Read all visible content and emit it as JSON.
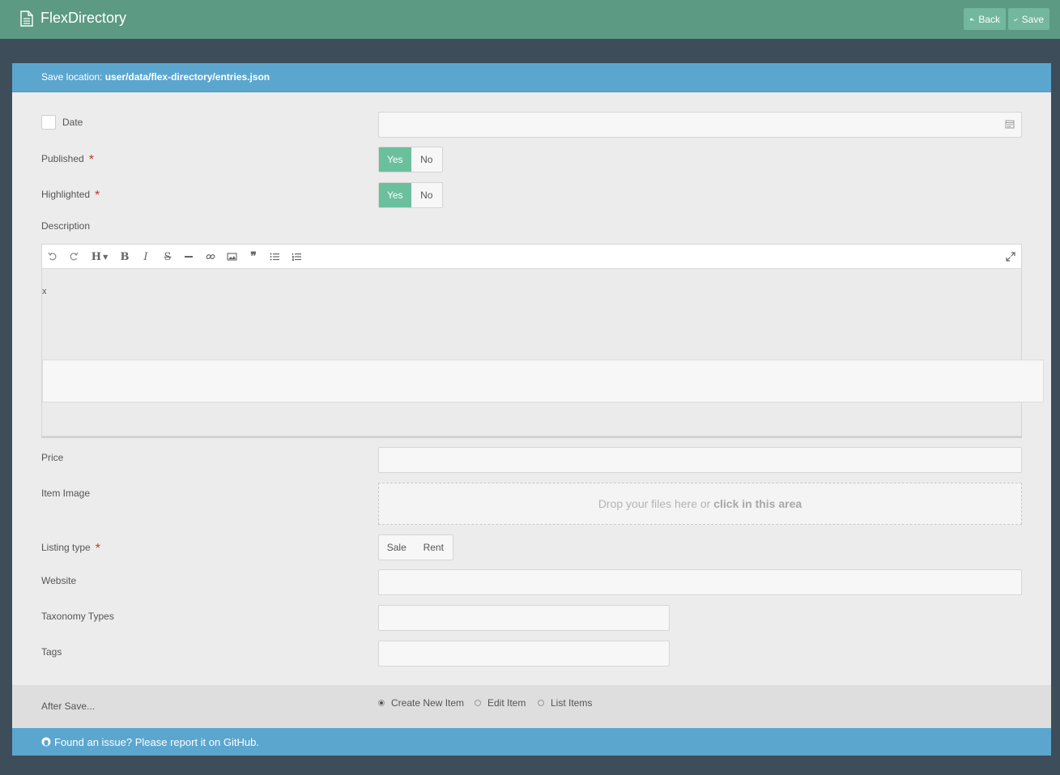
{
  "app": {
    "title": "FlexDirectory",
    "icon": "document-icon"
  },
  "toolbar": {
    "back_label": "Back",
    "save_label": "Save"
  },
  "save_location": {
    "prefix": "Save location: ",
    "path": "user/data/flex-directory/entries.json"
  },
  "form": {
    "date_label": "Date",
    "published_label": "Published",
    "highlighted_label": "Highlighted",
    "required_mark": "*",
    "yes_label": "Yes",
    "no_label": "No",
    "description_label": "Description",
    "description_text": "x",
    "price_label": "Price",
    "item_image_label": "Item Image",
    "dropzone_text": "Drop your files here or ",
    "dropzone_bold": "click in this area",
    "listing_type_label": "Listing type",
    "sale_label": "Sale",
    "rent_label": "Rent",
    "website_label": "Website",
    "taxonomy_label": "Taxonomy Types",
    "tags_label": "Tags"
  },
  "editor_tools": {
    "undo": "undo-icon",
    "redo": "redo-icon",
    "heading": "H",
    "bold": "B",
    "italic": "I",
    "strike": "S",
    "hr": "horizontal-rule-icon",
    "link": "link-icon",
    "image": "image-icon",
    "quote": "quote-icon",
    "ul": "bullet-list-icon",
    "ol": "numbered-list-icon",
    "fullscreen": "expand-icon"
  },
  "after_save": {
    "label": "After Save...",
    "options": [
      "Create New Item",
      "Edit Item",
      "List Items"
    ],
    "selected": "Create New Item"
  },
  "footer": {
    "text": "Found an issue? Please report it on GitHub."
  },
  "colors": {
    "header": "#5c9a84",
    "accent": "#5ba6cf",
    "toggle_on": "#6abf9c",
    "background": "#3d4d5a"
  }
}
